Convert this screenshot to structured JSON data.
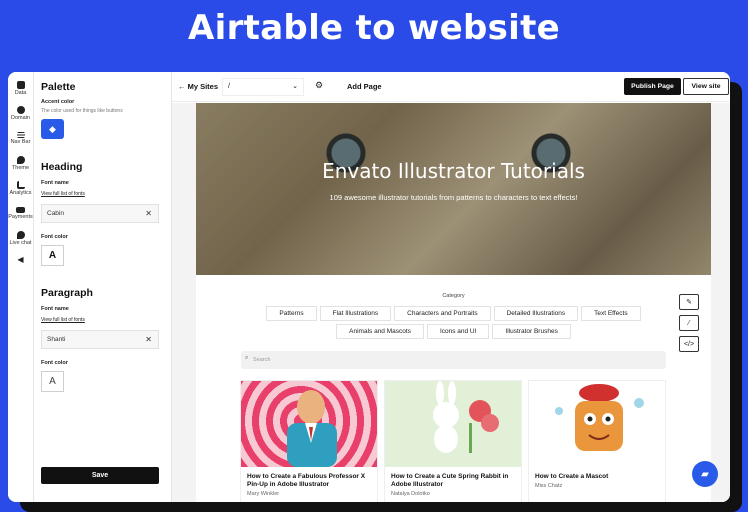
{
  "banner": {
    "title": "Airtable to website"
  },
  "rail": {
    "items": [
      {
        "label": "Data",
        "icon": "database-icon"
      },
      {
        "label": "Domain",
        "icon": "globe-icon"
      },
      {
        "label": "Nav Bar",
        "icon": "menu-icon"
      },
      {
        "label": "Theme",
        "icon": "palette-icon"
      },
      {
        "label": "Analytics",
        "icon": "chart-icon"
      },
      {
        "label": "Payments",
        "icon": "credit-card-icon"
      },
      {
        "label": "Live chat",
        "icon": "chat-icon"
      }
    ],
    "collapse_glyph": "◀"
  },
  "panel": {
    "palette_title": "Palette",
    "accent_label": "Accent color",
    "accent_hint": "The color used for things like buttons",
    "accent_color": "#2a5ae8",
    "heading_title": "Heading",
    "heading_font_label": "Font name",
    "heading_font_link": "View full list of fonts",
    "heading_font_value": "Cabin",
    "heading_color_label": "Font color",
    "paragraph_title": "Paragraph",
    "paragraph_font_label": "Font name",
    "paragraph_font_link": "View full list of fonts",
    "paragraph_font_value": "Shanti",
    "paragraph_color_label": "Font color",
    "color_glyph": "A",
    "clear_glyph": "✕",
    "save_label": "Save"
  },
  "topbar": {
    "back_label": "My Sites",
    "site_select_value": "/",
    "add_page_label": "Add Page",
    "publish_label": "Publish Page",
    "view_site_label": "View site"
  },
  "hero": {
    "title": "Envato Illustrator Tutorials",
    "subtitle": "109 awesome illustrator tutorials from patterns to characters to text effects!"
  },
  "filters": {
    "label": "Category",
    "row1": [
      "Patterns",
      "Flat Illustrations",
      "Characters and Portraits",
      "Detailed Illustrations",
      "Text Effects"
    ],
    "row2": [
      "Animals and Mascots",
      "Icons and UI",
      "Illustrator Brushes"
    ]
  },
  "search": {
    "placeholder": "Search"
  },
  "cards": [
    {
      "title": "How to Create a Fabulous Professor X Pin-Up in Adobe Illustrator",
      "author": "Mary Winkler"
    },
    {
      "title": "How to Create a Cute Spring Rabbit in Adobe Illustrator",
      "author": "Natalya Dolotko"
    },
    {
      "title": "How to Create a Mascot",
      "author": "Miss Chatz"
    }
  ]
}
